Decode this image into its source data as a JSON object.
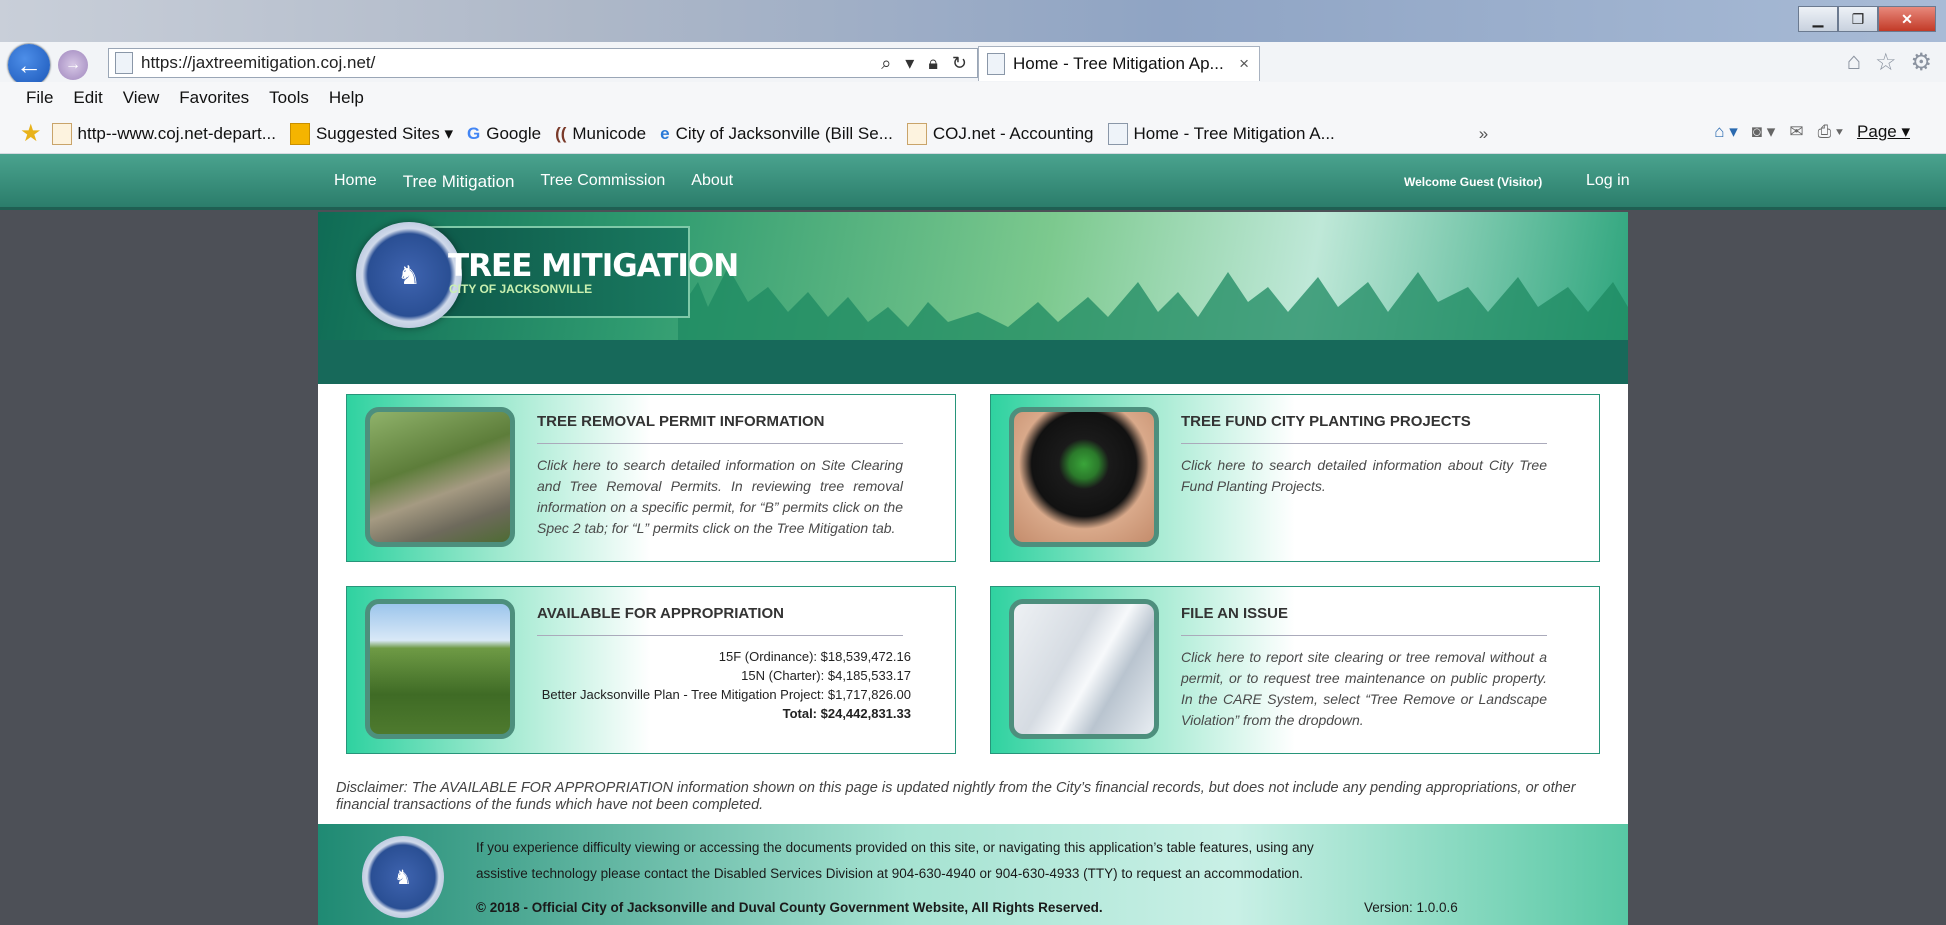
{
  "browser": {
    "window_title": "",
    "address_url": "https://jaxtreemitigation.coj.net/",
    "tab_label": "Home - Tree Mitigation Ap...",
    "tab_close": "×",
    "menu": [
      "File",
      "Edit",
      "View",
      "Favorites",
      "Tools",
      "Help"
    ],
    "favorites": [
      "http--www.coj.net-depart...",
      "Suggested Sites ▾",
      "Google",
      "Municode",
      "City of Jacksonville (Bill Se...",
      "COJ.net - Accounting",
      "Home - Tree Mitigation A..."
    ],
    "page_menu": "Page ▾",
    "chevron": "»"
  },
  "nav": {
    "links": [
      "Home",
      "Tree Mitigation",
      "Tree Commission",
      "About"
    ],
    "welcome": "Welcome Guest (Visitor)",
    "login": "Log in"
  },
  "logo": {
    "title": "TREE MITIGATION",
    "subtitle": "CITY OF JACKSONVILLE"
  },
  "cards": {
    "removal": {
      "title": "TREE REMOVAL PERMIT INFORMATION",
      "text": "Click here to search detailed information on Site Clearing and Tree Removal Permits. In reviewing tree removal information on a specific permit, for “B” permits click on the Spec 2 tab; for “L” permits click on the Tree Mitigation tab."
    },
    "fund": {
      "title": "TREE FUND CITY PLANTING PROJECTS",
      "text": "Click here to search detailed information about City Tree Fund Planting Projects."
    },
    "appropriation": {
      "title": "AVAILABLE FOR APPROPRIATION",
      "lines": [
        "15F (Ordinance): $18,539,472.16",
        "15N (Charter): $4,185,533.17",
        "Better Jacksonville Plan - Tree Mitigation Project: $1,717,826.00"
      ],
      "total": "Total: $24,442,831.33"
    },
    "issue": {
      "title": "FILE AN ISSUE",
      "text": "Click here to report site clearing or tree removal without a permit, or to request tree maintenance on public property. In the CARE System, select “Tree Remove or Landscape Violation” from the dropdown."
    }
  },
  "disclaimer": "Disclaimer: The AVAILABLE FOR APPROPRIATION information shown on this page is updated nightly from the City’s financial records, but does not include any pending appropriations, or other financial transactions of the funds which have not been completed.",
  "footer": {
    "line1": "If you experience difficulty viewing or accessing the documents provided on this site, or navigating this application’s table features, using any",
    "line2": "assistive technology please contact the Disabled Services Division at 904-630-4940 or 904-630-4933 (TTY) to request an accommodation.",
    "copyright": "© 2018 - Official City of Jacksonville and Duval County Government Website, All Rights Reserved.",
    "version": "Version: 1.0.0.6"
  },
  "colors": {
    "nav_green": "#2b7d6b",
    "card_border": "#27957a",
    "accent_teal": "#2fd2a0"
  }
}
